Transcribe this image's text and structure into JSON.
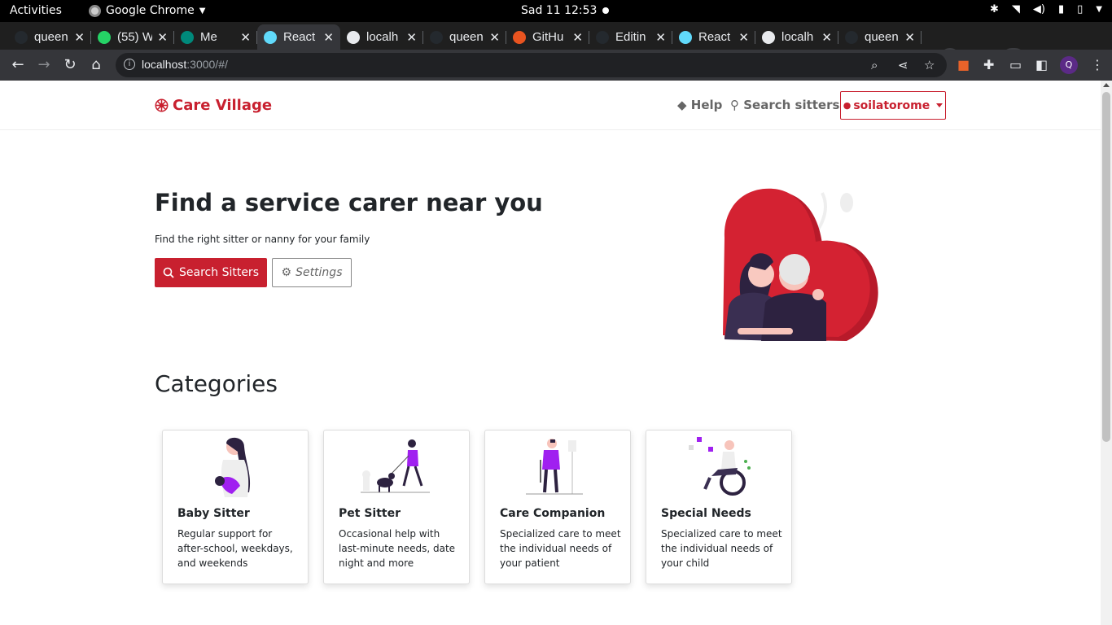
{
  "os": {
    "activities": "Activities",
    "app_name": "Google Chrome",
    "clock": "Sad 11  12:53"
  },
  "browser": {
    "tabs": [
      {
        "title": "queen",
        "favicon": "github-icon",
        "color": "#24292e"
      },
      {
        "title": "(55) W",
        "favicon": "whatsapp-icon",
        "color": "#25d366"
      },
      {
        "title": "Me",
        "favicon": "meet-icon",
        "color": "#00897b"
      },
      {
        "title": "React",
        "favicon": "react-icon",
        "color": "#61dafb",
        "active": true
      },
      {
        "title": "localh",
        "favicon": "globe-icon",
        "color": "#e8eaed"
      },
      {
        "title": "queen",
        "favicon": "github-icon",
        "color": "#24292e"
      },
      {
        "title": "GitHu",
        "favicon": "ubuntu-icon",
        "color": "#e95420"
      },
      {
        "title": "Editin",
        "favicon": "github-icon",
        "color": "#24292e"
      },
      {
        "title": "React",
        "favicon": "react-icon",
        "color": "#61dafb"
      },
      {
        "title": "localh",
        "favicon": "globe-icon",
        "color": "#e8eaed"
      },
      {
        "title": "queen",
        "favicon": "github-icon",
        "color": "#24292e"
      }
    ],
    "url_host": "localhost",
    "url_rest": ":3000/#/",
    "profile_initial": "Q"
  },
  "site": {
    "brand": "Care Village",
    "nav": {
      "help": "Help",
      "search": "Search sitters",
      "user": "soilatorome"
    },
    "hero": {
      "title": "Find a service carer near you",
      "subtitle": "Find the right sitter or nanny for your family",
      "search_button": "Search Sitters",
      "settings_button": "Settings"
    },
    "categories_title": "Categories",
    "categories": [
      {
        "title": "Baby Sitter",
        "desc": "Regular support for after-school, weekdays, and weekends"
      },
      {
        "title": "Pet Sitter",
        "desc": "Occasional help with last-minute needs, date night and more"
      },
      {
        "title": "Care Companion",
        "desc": "Specialized care to meet the individual needs of your patient"
      },
      {
        "title": "Special Needs",
        "desc": "Specialized care to meet the individual needs of your child"
      }
    ],
    "colors": {
      "brand": "#c8202f",
      "accent_purple": "#7b1fe0"
    }
  }
}
